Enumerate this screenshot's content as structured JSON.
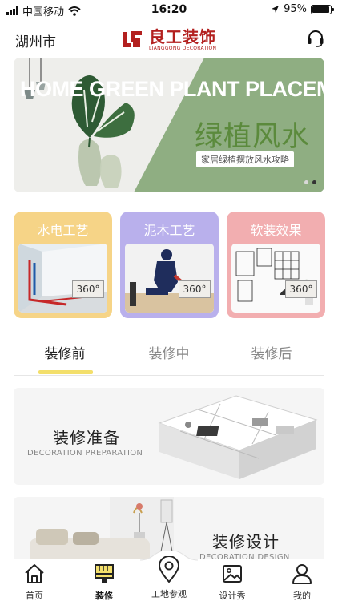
{
  "status_bar": {
    "carrier": "中国移动",
    "time": "16:20",
    "battery": "95%",
    "battery_level": 0.95
  },
  "header": {
    "city": "湖州市",
    "logo_cn": "良工装饰",
    "logo_en": "LIANGGONG DECORATION"
  },
  "banner": {
    "english_title": "HOME GREEN PLANT PLACEMENT",
    "title": "绿植风水",
    "subtitle": "家居绿植摆放风水攻略",
    "slide_count": 2,
    "active_slide": 2
  },
  "craft_cards": [
    {
      "title": "水电工艺",
      "badge": "360°",
      "color": "#f6d487"
    },
    {
      "title": "泥木工艺",
      "badge": "360°",
      "color": "#b9b0ec"
    },
    {
      "title": "软装效果",
      "badge": "360°",
      "color": "#f2aeb0"
    }
  ],
  "tabs": [
    {
      "label": "装修前",
      "active": true
    },
    {
      "label": "装修中",
      "active": false
    },
    {
      "label": "装修后",
      "active": false
    }
  ],
  "sections": [
    {
      "title": "装修准备",
      "subtitle": "DECORATION PREPARATION"
    },
    {
      "title": "装修设计",
      "subtitle": "DECORATION DESIGN"
    }
  ],
  "bottom_nav": [
    {
      "label": "首页",
      "icon": "home-icon",
      "active": false
    },
    {
      "label": "装修",
      "icon": "paint-brush-icon",
      "active": true
    },
    {
      "label": "工地参观",
      "icon": "location-pin-icon",
      "active": false
    },
    {
      "label": "设计秀",
      "icon": "image-icon",
      "active": false
    },
    {
      "label": "我的",
      "icon": "user-icon",
      "active": false
    }
  ],
  "colors": {
    "brand_red": "#b3201f",
    "tab_accent": "#f3df6b",
    "banner_green": "#8fae82"
  }
}
